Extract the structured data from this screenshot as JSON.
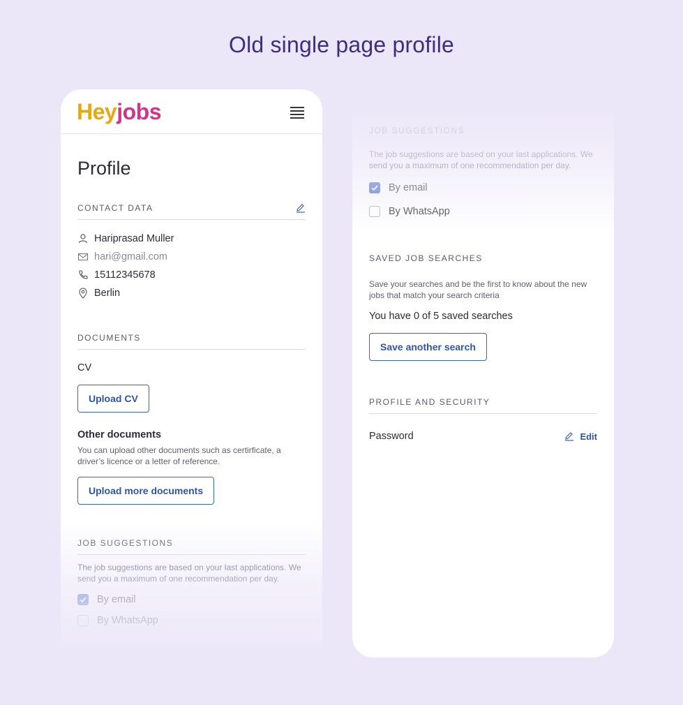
{
  "heading": "Old single page profile",
  "colors": {
    "background": "#ebe7f8",
    "accent": "#3a64b8",
    "logo_yellow": "#e2a81a",
    "logo_pink": "#d1358a"
  },
  "left_screen": {
    "logo": {
      "part1": "Hey",
      "part2": "jobs"
    },
    "page_title": "Profile",
    "contact": {
      "header": "CONTACT DATA",
      "name": "Hariprasad Muller",
      "email": "hari@gmail.com",
      "phone": "15112345678",
      "city": "Berlin"
    },
    "documents": {
      "header": "DOCUMENTS",
      "cv_label": "CV",
      "upload_cv": "Upload CV",
      "other_label": "Other documents",
      "other_desc": "You can upload other documents such as certirficate, a driver’s licence or a letter of reference.",
      "upload_more": "Upload more documents"
    },
    "job_suggestions": {
      "header": "JOB SUGGESTIONS",
      "desc": "The job suggestions are based on your last applications. We send you a maximum of one recommendation per day.",
      "by_email": "By email",
      "by_whatsapp": "By WhatsApp"
    }
  },
  "right_screen": {
    "job_suggestions": {
      "header": "JOB SUGGESTIONS",
      "desc": "The job suggestions are based on your last applications. We send you a maximum of one recommendation per day.",
      "by_email": "By email",
      "by_email_checked": true,
      "by_whatsapp": "By WhatsApp",
      "by_whatsapp_checked": false
    },
    "saved_searches": {
      "header": "SAVED JOB SEARCHES",
      "desc": "Save your searches and be the first to know about the new jobs that match your search criteria",
      "count_text": "You have 0 of 5 saved searches",
      "button": "Save another search"
    },
    "security": {
      "header": "PROFILE AND SECURITY",
      "password_label": "Password",
      "edit": "Edit"
    }
  }
}
